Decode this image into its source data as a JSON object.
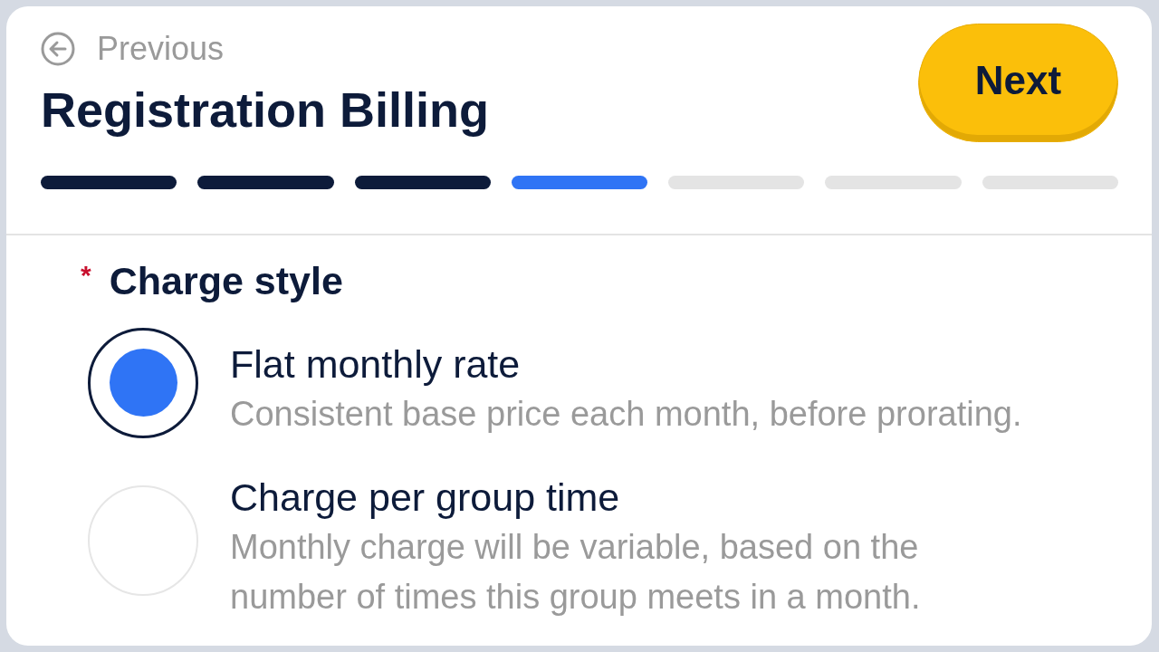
{
  "header": {
    "previous": "Previous",
    "title": "Registration Billing",
    "next": "Next"
  },
  "progress": [
    {
      "completed": true,
      "current": false
    },
    {
      "completed": true,
      "current": false
    },
    {
      "completed": true,
      "current": false
    },
    {
      "completed": false,
      "current": true
    },
    {
      "completed": false,
      "current": false
    },
    {
      "completed": false,
      "current": false
    },
    {
      "completed": false,
      "current": false
    }
  ],
  "field": {
    "required_mark": "*",
    "label": "Charge style",
    "options": [
      {
        "title": "Flat monthly rate",
        "description": "Consistent base price each month, before prorating.",
        "selected": true
      },
      {
        "title": "Charge per group time",
        "description": "Monthly charge will be variable, based on the number of times this group meets in a month.",
        "selected": false
      }
    ]
  }
}
